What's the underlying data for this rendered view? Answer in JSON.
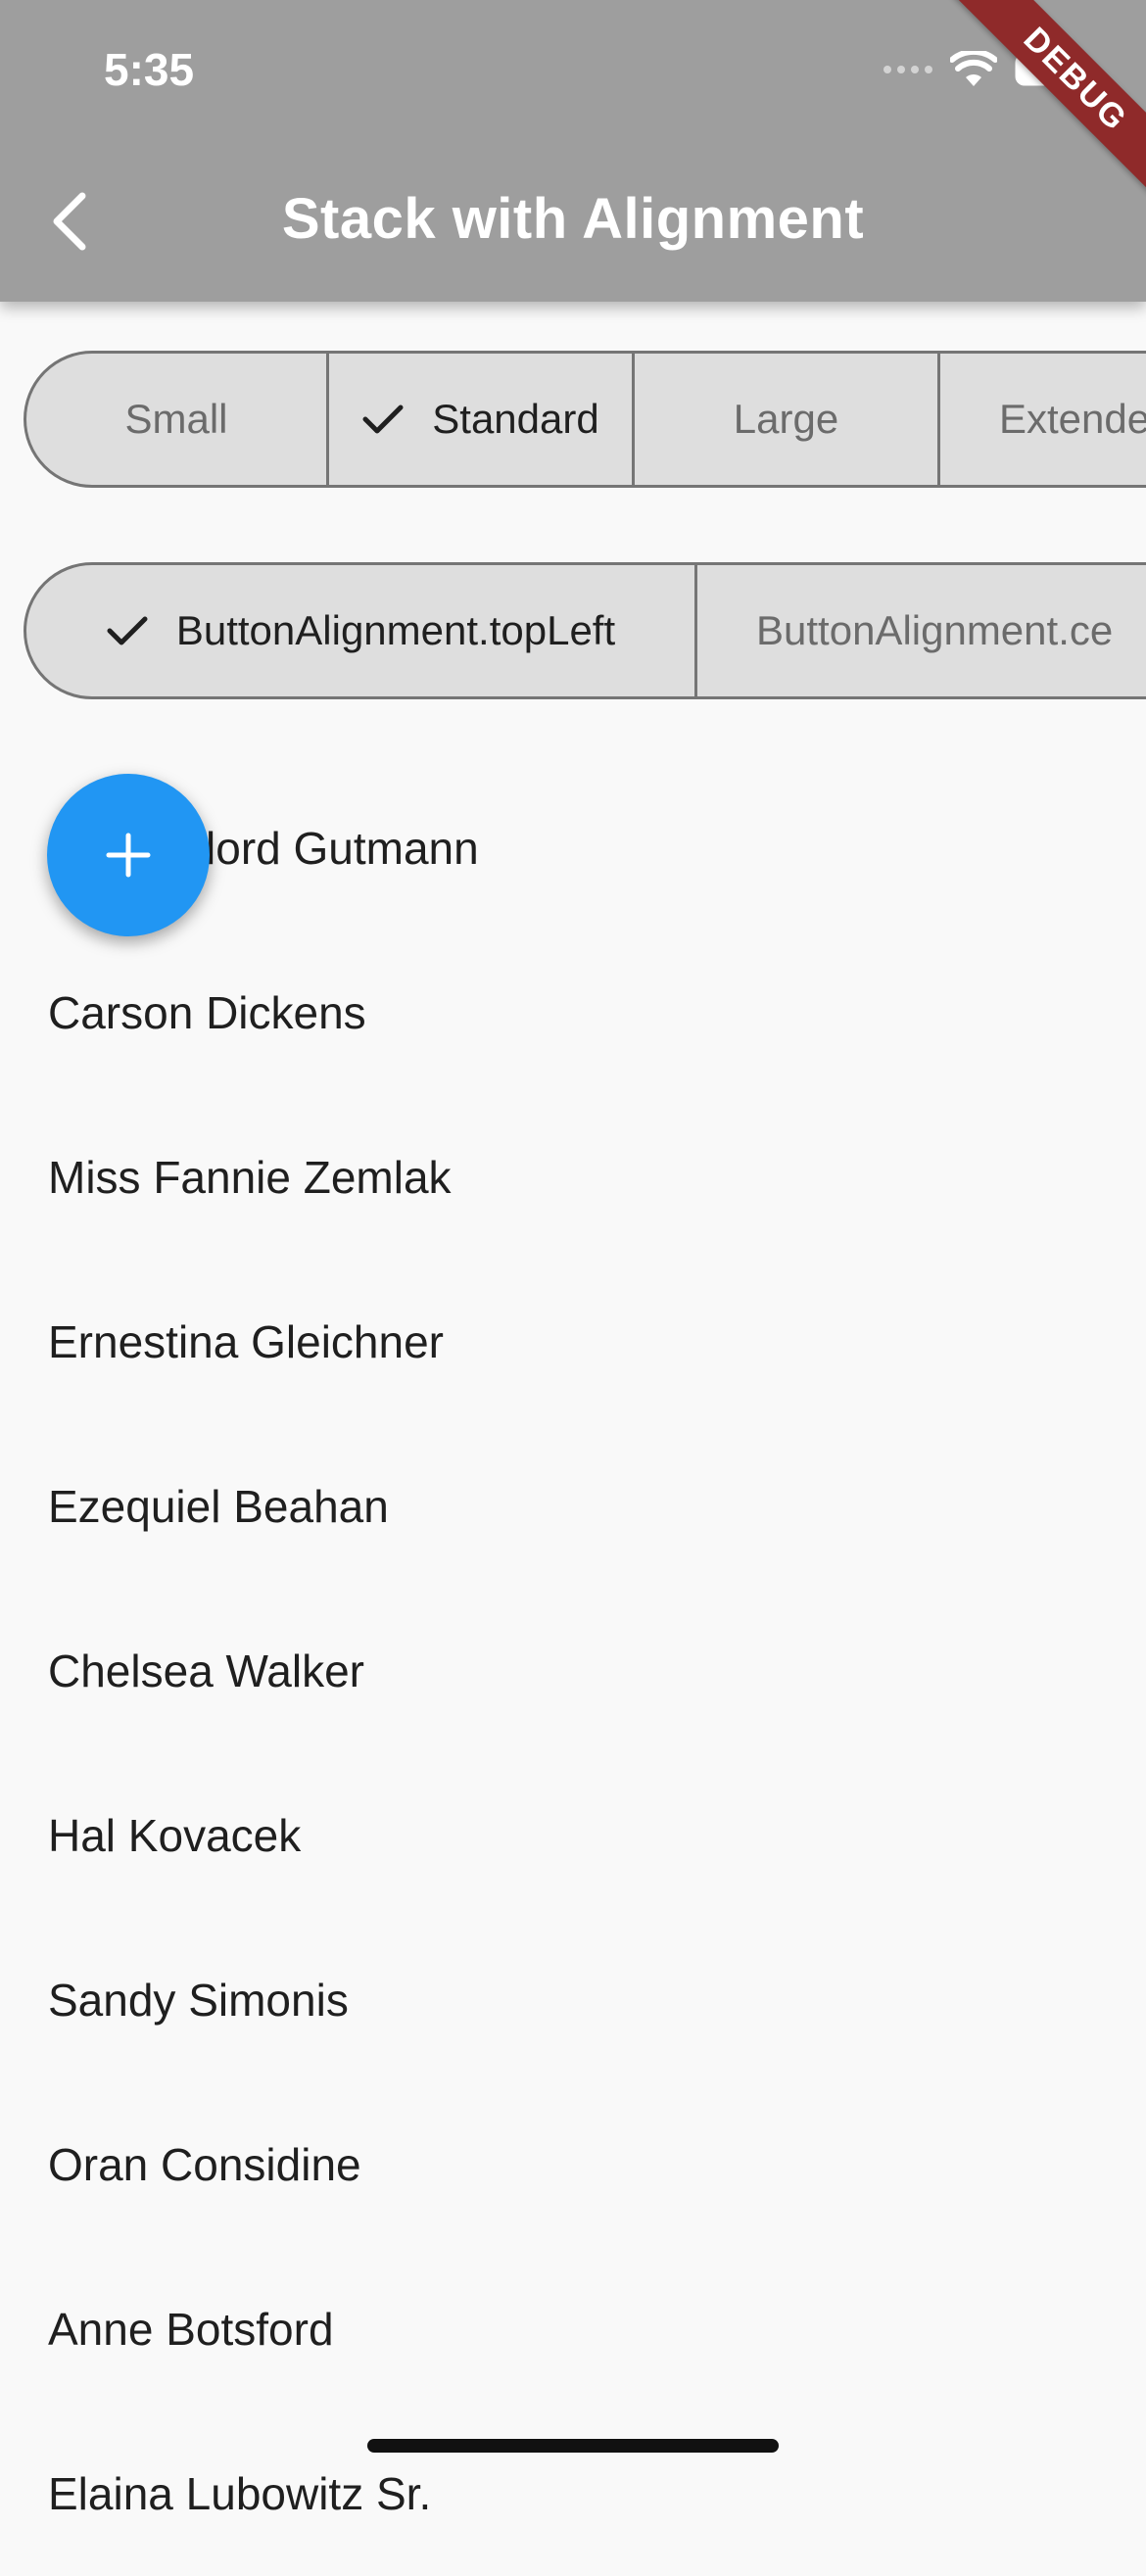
{
  "status_bar": {
    "time": "5:35"
  },
  "app_bar": {
    "title": "Stack with Alignment",
    "back_icon": "chevron-left-icon"
  },
  "debug_banner": "DEBUG",
  "size_segments": [
    {
      "label": "Small",
      "selected": false
    },
    {
      "label": "Standard",
      "selected": true
    },
    {
      "label": "Large",
      "selected": false
    },
    {
      "label": "Extende",
      "selected": false
    }
  ],
  "alignment_segments": [
    {
      "label": "ButtonAlignment.topLeft",
      "selected": true
    },
    {
      "label": "ButtonAlignment.ce",
      "selected": false
    }
  ],
  "fab": {
    "icon": "plus-icon",
    "color": "#2196f3"
  },
  "list_items": [
    "Mr. Gaylord Gutmann",
    "Carson Dickens",
    "Miss Fannie Zemlak",
    "Ernestina Gleichner",
    "Ezequiel Beahan",
    "Chelsea Walker",
    "Hal Kovacek",
    "Sandy Simonis",
    "Oran Considine",
    "Anne Botsford",
    "Elaina Lubowitz Sr."
  ],
  "colors": {
    "app_bar": "#9e9e9e",
    "segment_bg": "#dedede",
    "accent": "#2196f3",
    "debug_ribbon": "#8f2a2a"
  }
}
